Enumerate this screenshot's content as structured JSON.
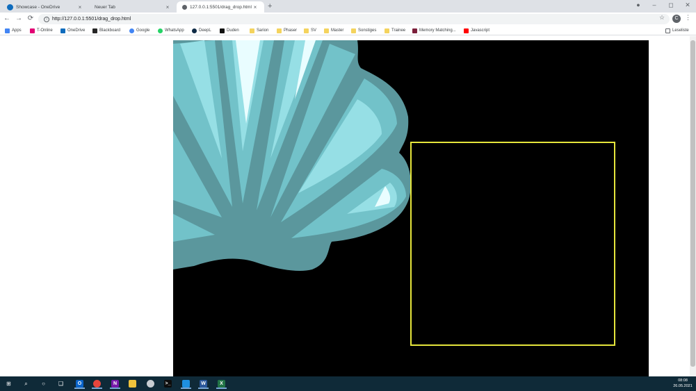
{
  "tabs": [
    {
      "title": "Showcase - OneDrive",
      "active": false
    },
    {
      "title": "Neuer Tab",
      "active": false
    },
    {
      "title": "127.0.0.1:5501/drag_drop.html",
      "active": true
    }
  ],
  "tab_close": "×",
  "new_tab": "+",
  "window_controls": {
    "minimize": "–",
    "maximize": "◻",
    "close": "✕"
  },
  "toolbar": {
    "back": "←",
    "forward": "→",
    "reload": "⟳",
    "url": "http://127.0.0.1:5501/drag_drop.html",
    "star": "☆",
    "profile_initial": "C",
    "menu": "⋮"
  },
  "bookmarks": [
    {
      "label": "Apps",
      "icon": "apps-grid-icon",
      "color": "#4285f4"
    },
    {
      "label": "T-Online",
      "icon": "t-online-icon",
      "color": "#e20074"
    },
    {
      "label": "OneDrive",
      "icon": "onedrive-icon",
      "color": "#0f6cbd"
    },
    {
      "label": "Blackboard",
      "icon": "blackboard-icon",
      "color": "#262626"
    },
    {
      "label": "Google",
      "icon": "google-icon",
      "color": "#4285f4"
    },
    {
      "label": "WhatsApp",
      "icon": "whatsapp-icon",
      "color": "#25d366"
    },
    {
      "label": "DeepL",
      "icon": "deepl-icon",
      "color": "#0f2b46"
    },
    {
      "label": "Duden",
      "icon": "duden-icon",
      "color": "#111111"
    },
    {
      "label": "Sarion",
      "icon": "folder-icon",
      "color": "#f4d35e"
    },
    {
      "label": "Phaser",
      "icon": "folder-icon",
      "color": "#f4d35e"
    },
    {
      "label": "SV",
      "icon": "folder-icon",
      "color": "#f4d35e"
    },
    {
      "label": "Master",
      "icon": "folder-icon",
      "color": "#f4d35e"
    },
    {
      "label": "Sonstiges",
      "icon": "folder-icon",
      "color": "#f4d35e"
    },
    {
      "label": "Trainee",
      "icon": "folder-icon",
      "color": "#f4d35e"
    },
    {
      "label": "Memory Matching...",
      "icon": "memory-icon",
      "color": "#7b1f3a"
    },
    {
      "label": "Javascript",
      "icon": "youtube-icon",
      "color": "#ff0000"
    }
  ],
  "reading_list": "Leseliste",
  "canvas": {
    "background": "#000000",
    "dropzone_border": "#e6e63c",
    "shell_colors": [
      "#5b979d",
      "#72c2c9",
      "#96dfe5",
      "#e9fdff"
    ]
  },
  "taskbar": {
    "apps": [
      {
        "name": "start",
        "label": "⊞"
      },
      {
        "name": "search",
        "label": "⌕"
      },
      {
        "name": "cortana",
        "label": "○"
      },
      {
        "name": "task-view",
        "label": "❑"
      },
      {
        "name": "outlook",
        "label": "O",
        "color": "#0a64c9"
      },
      {
        "name": "chrome",
        "label": "",
        "color": "#e8453c"
      },
      {
        "name": "onenote",
        "label": "N",
        "color": "#7719aa"
      },
      {
        "name": "file-explorer",
        "label": "",
        "color": "#f0c33c"
      },
      {
        "name": "app-cloud",
        "label": "",
        "color": "#c8cdd2"
      },
      {
        "name": "terminal",
        "label": ">_",
        "color": "#0c0c0c"
      },
      {
        "name": "vscode",
        "label": "",
        "color": "#1e8fe0"
      },
      {
        "name": "word",
        "label": "W",
        "color": "#2b579a"
      },
      {
        "name": "excel",
        "label": "X",
        "color": "#217346"
      }
    ],
    "time": "08:08",
    "date": "26.05.2021"
  }
}
